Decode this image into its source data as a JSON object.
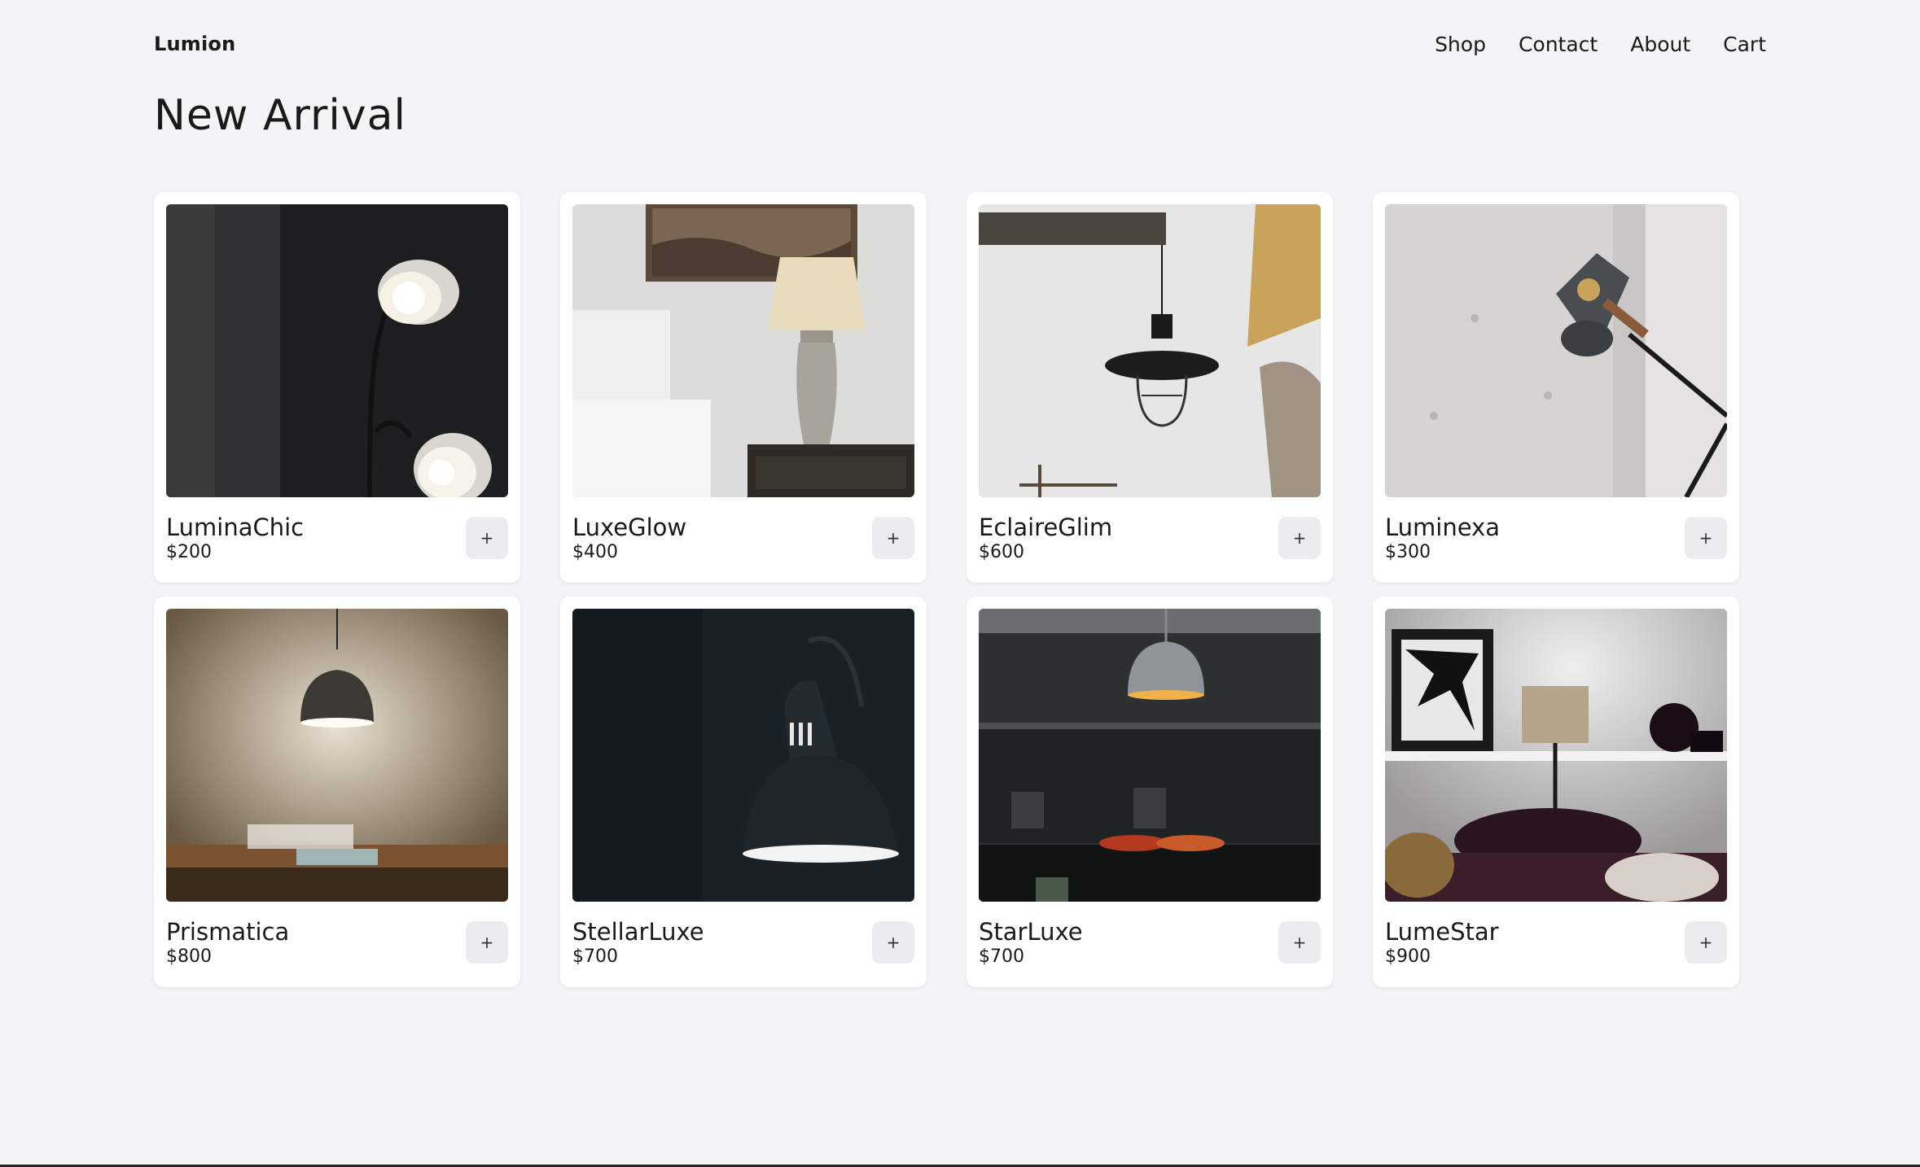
{
  "header": {
    "logo": "Lumion",
    "nav": [
      "Shop",
      "Contact",
      "About",
      "Cart"
    ]
  },
  "page_title": "New Arrival",
  "add_button_label": "+",
  "products": [
    {
      "name": "LuminaChic",
      "price": "$200",
      "icon": "floor-lamp-photo"
    },
    {
      "name": "LuxeGlow",
      "price": "$400",
      "icon": "bedside-lamp-photo"
    },
    {
      "name": "EclaireGlim",
      "price": "$600",
      "icon": "cage-pendant-photo"
    },
    {
      "name": "Luminexa",
      "price": "$300",
      "icon": "wall-lamp-photo"
    },
    {
      "name": "Prismatica",
      "price": "$800",
      "icon": "dining-pendant-photo"
    },
    {
      "name": "StellarLuxe",
      "price": "$700",
      "icon": "dark-lamp-photo"
    },
    {
      "name": "StarLuxe",
      "price": "$700",
      "icon": "kitchen-pendant-photo"
    },
    {
      "name": "LumeStar",
      "price": "$900",
      "icon": "shelf-lamp-photo"
    }
  ],
  "colors": {
    "background": "#f4f4f6",
    "card": "#ffffff",
    "button": "#ececee",
    "text": "#1a1a1a"
  }
}
